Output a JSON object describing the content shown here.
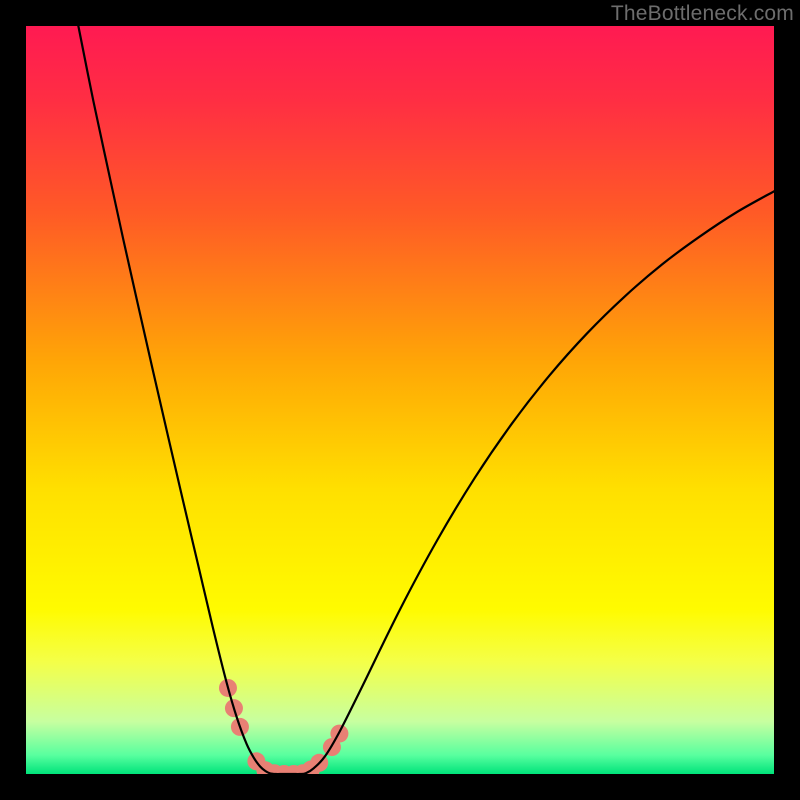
{
  "watermark": "TheBottleneck.com",
  "chart_data": {
    "type": "line",
    "title": "",
    "xlabel": "",
    "ylabel": "",
    "xlim": [
      0,
      100
    ],
    "ylim": [
      0,
      100
    ],
    "gradient_stops": [
      {
        "offset": 0.0,
        "color": "#ff1a52"
      },
      {
        "offset": 0.1,
        "color": "#ff2e43"
      },
      {
        "offset": 0.25,
        "color": "#ff5a26"
      },
      {
        "offset": 0.45,
        "color": "#ffa606"
      },
      {
        "offset": 0.62,
        "color": "#ffe000"
      },
      {
        "offset": 0.78,
        "color": "#fffb00"
      },
      {
        "offset": 0.85,
        "color": "#f4ff48"
      },
      {
        "offset": 0.93,
        "color": "#c7ffa0"
      },
      {
        "offset": 0.975,
        "color": "#58ff9f"
      },
      {
        "offset": 1.0,
        "color": "#00e37a"
      }
    ],
    "series": [
      {
        "name": "left-branch",
        "x": [
          7,
          9,
          11,
          13,
          15,
          17,
          19,
          21,
          23,
          25,
          26.8,
          28.2,
          29.5,
          30.5,
          31.3,
          32,
          32.6
        ],
        "y": [
          100,
          90,
          80.7,
          71.5,
          62.6,
          53.8,
          45.1,
          36.5,
          28.0,
          19.5,
          12.3,
          7.5,
          4.0,
          2.1,
          1.0,
          0.4,
          0.1
        ]
      },
      {
        "name": "trough",
        "x": [
          32.6,
          33.4,
          34.2,
          35.0,
          35.8,
          36.6,
          37.4
        ],
        "y": [
          0.1,
          0.0,
          0.0,
          0.0,
          0.0,
          0.0,
          0.1
        ]
      },
      {
        "name": "right-branch",
        "x": [
          37.4,
          38.5,
          40,
          42,
          45,
          50,
          55,
          60,
          65,
          70,
          75,
          80,
          85,
          90,
          95,
          100
        ],
        "y": [
          0.1,
          0.8,
          2.4,
          5.8,
          11.8,
          22.0,
          31.3,
          39.6,
          46.9,
          53.3,
          58.9,
          63.8,
          68.1,
          71.8,
          75.1,
          77.9
        ]
      }
    ],
    "markers": {
      "name": "highlight-points",
      "color": "#e88074",
      "radius_px": 9,
      "points": [
        {
          "x": 27.0,
          "y": 11.5
        },
        {
          "x": 27.8,
          "y": 8.8
        },
        {
          "x": 28.6,
          "y": 6.3
        },
        {
          "x": 30.8,
          "y": 1.7
        },
        {
          "x": 32.0,
          "y": 0.5
        },
        {
          "x": 33.2,
          "y": 0.1
        },
        {
          "x": 34.5,
          "y": 0.0
        },
        {
          "x": 35.8,
          "y": 0.0
        },
        {
          "x": 37.0,
          "y": 0.1
        },
        {
          "x": 38.1,
          "y": 0.6
        },
        {
          "x": 39.2,
          "y": 1.5
        },
        {
          "x": 40.9,
          "y": 3.6
        },
        {
          "x": 41.9,
          "y": 5.4
        }
      ]
    }
  }
}
